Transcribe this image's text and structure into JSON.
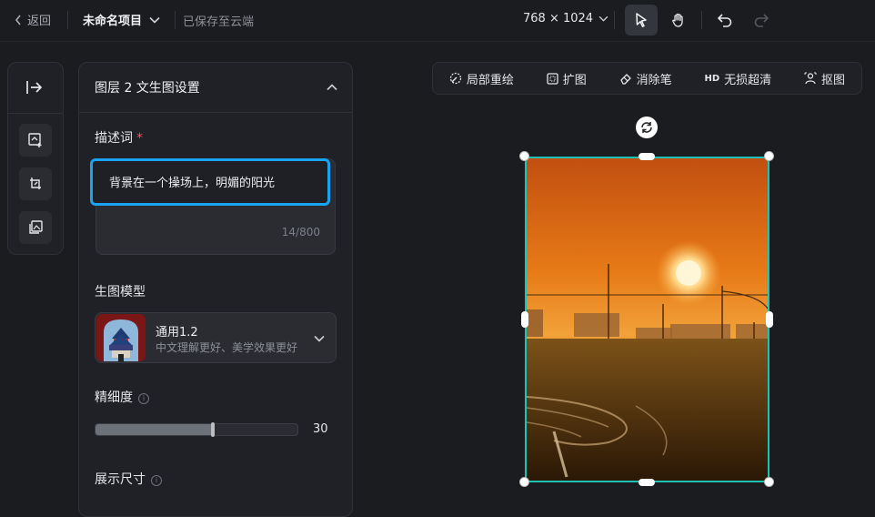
{
  "header": {
    "back_label": "返回",
    "project_name": "未命名项目",
    "save_status": "已保存至云端",
    "canvas_size": "768 × 1024"
  },
  "panel": {
    "title": "图层 2 文生图设置",
    "prompt_label": "描述词",
    "required_mark": "*",
    "prompt_text": "背景在一个操场上，明媚的阳光",
    "char_count": "14/800",
    "model_label": "生图模型",
    "model_name": "通用1.2",
    "model_desc": "中文理解更好、美学效果更好",
    "detail_label": "精细度",
    "detail_value": "30",
    "detail_fraction": 0.58,
    "display_size_label": "展示尺寸"
  },
  "toolbar": {
    "inpaint": "局部重绘",
    "expand": "扩图",
    "eraser": "消除笔",
    "hd_badge": "HD",
    "upscale": "无损超清",
    "cutout": "抠图"
  },
  "colors": {
    "accent_blue": "#1aa3f2",
    "selection": "#1fc2b7",
    "required": "#ff4d5b"
  }
}
